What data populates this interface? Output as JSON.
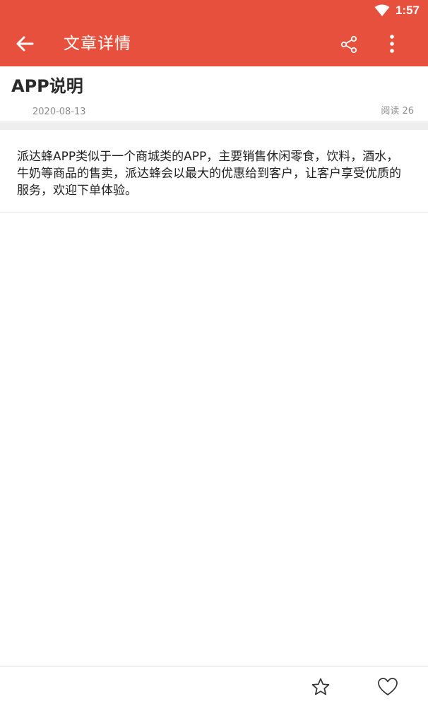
{
  "status_bar": {
    "time": "1:57",
    "wifi_icon": "wifi-icon"
  },
  "app_bar": {
    "title": "文章详情",
    "back_icon": "arrow-left-icon",
    "share_icon": "share-icon",
    "more_icon": "more-vertical-icon",
    "background_color": "#e8503e"
  },
  "article": {
    "title": "APP说明",
    "date": "2020-08-13",
    "reads_label": "阅读 26",
    "body": "派达蜂APP类似于一个商城类的APP，主要销售休闲零食，饮料，酒水，牛奶等商品的售卖，派达蜂会以最大的优惠给到客户，让客户享受优质的服务，欢迎下单体验。"
  },
  "bottom_bar": {
    "favorite_icon": "star-icon",
    "like_icon": "heart-icon"
  }
}
